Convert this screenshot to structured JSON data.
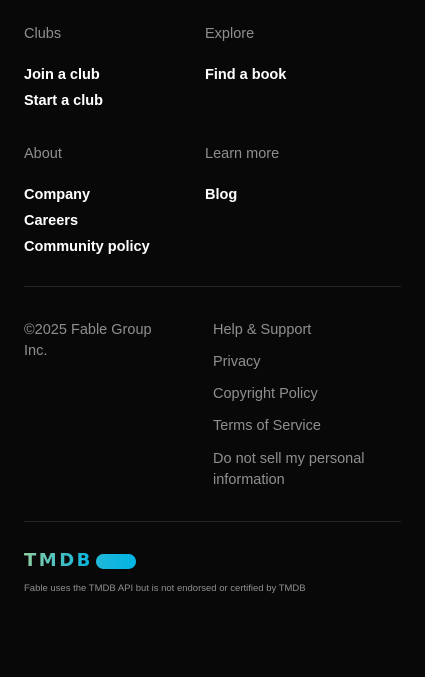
{
  "sections": {
    "clubs": {
      "heading": "Clubs",
      "links": [
        "Join a club",
        "Start a club"
      ]
    },
    "explore": {
      "heading": "Explore",
      "links": [
        "Find a book"
      ]
    },
    "about": {
      "heading": "About",
      "links": [
        "Company",
        "Careers",
        "Community policy"
      ]
    },
    "learn_more": {
      "heading": "Learn more",
      "links": [
        "Blog"
      ]
    }
  },
  "copyright": "©2025 Fable Group Inc.",
  "legal_links": [
    "Help & Support",
    "Privacy",
    "Copyright Policy",
    "Terms of Service",
    "Do not sell my personal information"
  ],
  "tmdb": {
    "logo_text": "TMDB",
    "disclaimer": "Fable uses the TMDB API but is not endorsed or certified by TMDB",
    "colors": {
      "green": "#90cea1",
      "blue": "#01b4e4"
    }
  },
  "colors": {
    "background": "#080808",
    "muted_text": "#8e8e8e",
    "link_text": "#ffffff",
    "divider": "#262626"
  }
}
